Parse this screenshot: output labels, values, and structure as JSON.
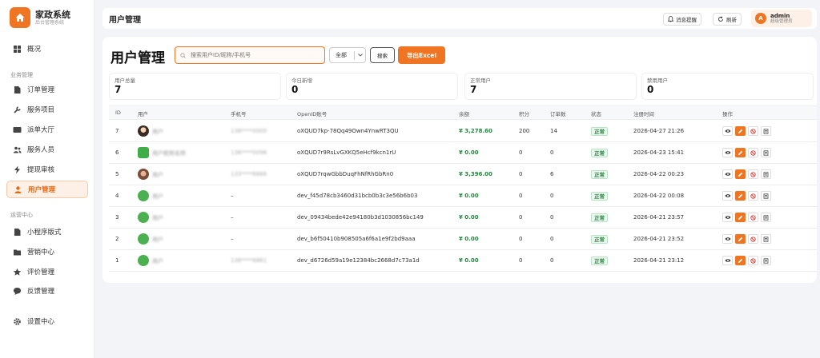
{
  "brand": {
    "title": "家政系统",
    "subtitle": "后台管理系统"
  },
  "sidebar": {
    "items": [
      {
        "label": "概况",
        "icon": "dashboard-icon"
      },
      {
        "label": "订单管理",
        "icon": "document-icon"
      },
      {
        "label": "服务项目",
        "icon": "wrench-icon"
      },
      {
        "label": "派单大厅",
        "icon": "tv-icon"
      },
      {
        "label": "服务人员",
        "icon": "people-icon"
      },
      {
        "label": "提现审核",
        "icon": "lightning-icon"
      },
      {
        "label": "用户管理",
        "icon": "user-icon",
        "active": true
      },
      {
        "label": "小程序版式",
        "icon": "document-icon"
      },
      {
        "label": "营销中心",
        "icon": "folder-icon"
      },
      {
        "label": "评价管理",
        "icon": "star-icon"
      },
      {
        "label": "反馈管理",
        "icon": "chat-icon"
      },
      {
        "label": "设置中心",
        "icon": "gear-icon"
      }
    ],
    "sections": [
      "业务管理",
      "运营中心"
    ]
  },
  "header": {
    "title": "用户管理",
    "notify_label": "消息提醒",
    "refresh_label": "刷新",
    "user": {
      "name": "admin",
      "role": "超级管理员",
      "initial": "A"
    }
  },
  "main": {
    "title": "用户管理",
    "search_placeholder": "搜索用户ID/昵称/手机号",
    "filter_value": "全部",
    "search_button": "搜索",
    "export_button": "导出Excel",
    "stats": [
      {
        "label": "用户总量",
        "value": "7"
      },
      {
        "label": "今日新增",
        "value": "0"
      },
      {
        "label": "正常用户",
        "value": "7"
      },
      {
        "label": "禁用用户",
        "value": "0"
      }
    ],
    "columns": [
      "ID",
      "用户",
      "手机号",
      "OpenID账号",
      "余额",
      "积分",
      "订单数",
      "状态",
      "注册时间",
      "操作"
    ],
    "rows": [
      {
        "id": "7",
        "name": "用户",
        "phone": "138****0000",
        "openid": "oXQUD7kp-78Qq49Own4YnwRT3QU",
        "balance": "¥ 3,278.60",
        "points": "200",
        "orders": "14",
        "status": "正常",
        "time": "2026-04-27 21:26",
        "avatar": "photo1"
      },
      {
        "id": "6",
        "name": "用户昵称名称",
        "phone": "136****0096",
        "openid": "oXQUD7r9RsLvGXKQ5eHcf9kcn1rU",
        "balance": "¥ 0.00",
        "points": "0",
        "orders": "0",
        "status": "正常",
        "time": "2026-04-23 15:41",
        "avatar": "photo2"
      },
      {
        "id": "5",
        "name": "用户",
        "phone": "133****6666",
        "openid": "oXQUD7rqwGbbDuqFhNfRhGbRn0",
        "balance": "¥ 3,396.00",
        "points": "0",
        "orders": "6",
        "status": "正常",
        "time": "2026-04-22 00:23",
        "avatar": "photo3"
      },
      {
        "id": "4",
        "name": "用户",
        "phone": "–",
        "openid": "dev_f45d78cb3460d31bcb0b3c3e56b6b03",
        "balance": "¥ 0.00",
        "points": "0",
        "orders": "0",
        "status": "正常",
        "time": "2026-04-22 00:08",
        "avatar": "green"
      },
      {
        "id": "3",
        "name": "用户",
        "phone": "–",
        "openid": "dev_09434bede42e94180b3d1030856bc149",
        "balance": "¥ 0.00",
        "points": "0",
        "orders": "0",
        "status": "正常",
        "time": "2026-04-21 23:57",
        "avatar": "green"
      },
      {
        "id": "2",
        "name": "用户",
        "phone": "–",
        "openid": "dev_b6f50410b908505a6f6a1e9f2bd9aaa",
        "balance": "¥ 0.00",
        "points": "0",
        "orders": "0",
        "status": "正常",
        "time": "2026-04-21 23:52",
        "avatar": "green"
      },
      {
        "id": "1",
        "name": "用户",
        "phone": "138****8861",
        "openid": "dev_d6726d59a19e12384bc2668d7c73a1d",
        "balance": "¥ 0.00",
        "points": "0",
        "orders": "0",
        "status": "正常",
        "time": "2026-04-21 23:12",
        "avatar": "green"
      }
    ]
  },
  "colors": {
    "accent": "#f07522",
    "success": "#1f8a3b"
  }
}
